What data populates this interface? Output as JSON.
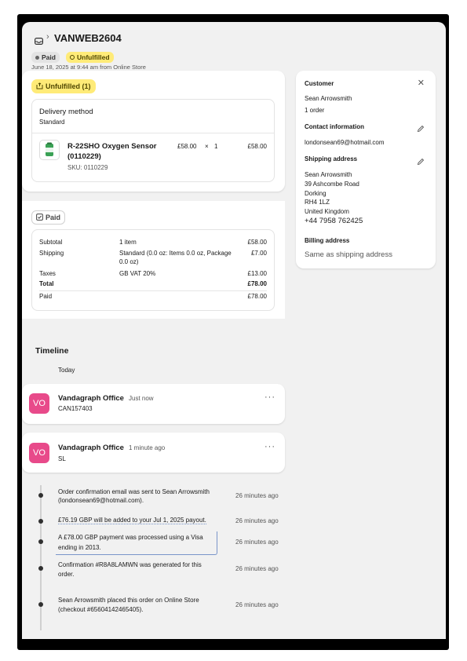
{
  "header": {
    "order_number": "VANWEB2604",
    "paid_badge": "Paid",
    "fulfillment_badge": "Unfulfilled",
    "date_line": "June 18, 2025 at 9:44 am from Online Store"
  },
  "fulfillment": {
    "status_label": "Unfulfilled (1)",
    "delivery_method_label": "Delivery method",
    "delivery_method": "Standard",
    "item": {
      "name_line1": "R-22SHO Oxygen Sensor",
      "name_line2": "(0110229)",
      "sku": "SKU: 0110229",
      "unit_price": "£58.00",
      "times": "×",
      "quantity": "1",
      "total": "£58.00"
    }
  },
  "payment": {
    "status_label": "Paid",
    "rows": {
      "subtotal": {
        "label": "Subtotal",
        "desc": "1 item",
        "amount": "£58.00"
      },
      "shipping": {
        "label": "Shipping",
        "desc_line1": "Standard (0.0 oz: Items 0.0 oz, Package",
        "desc_line2": "0.0 oz)",
        "amount": "£7.00"
      },
      "taxes": {
        "label": "Taxes",
        "desc": "GB VAT 20%",
        "amount": "£13.00"
      },
      "total": {
        "label": "Total",
        "amount": "£78.00"
      },
      "paid": {
        "label": "Paid",
        "amount": "£78.00"
      }
    }
  },
  "customer": {
    "section_title": "Customer",
    "name": "Sean Arrowsmith",
    "orders": "1 order",
    "contact_title": "Contact information",
    "email": "londonsean69@hotmail.com",
    "shipping_title": "Shipping address",
    "address": [
      "Sean Arrowsmith",
      "39 Ashcombe Road",
      "Dorking",
      "RH4 1LZ",
      "United Kingdom"
    ],
    "phone": "+44 7958 762425",
    "billing_title": "Billing address",
    "billing_value": "Same as shipping address"
  },
  "timeline": {
    "title": "Timeline",
    "today_label": "Today",
    "comments": [
      {
        "initials": "VO",
        "author": "Vandagraph Office",
        "time": "Just now",
        "text": "CAN157403",
        "more": "···"
      },
      {
        "initials": "VO",
        "author": "Vandagraph Office",
        "time": "1 minute ago",
        "text": "SL",
        "more": "···"
      }
    ],
    "events": [
      {
        "line1": "Order confirmation email was sent to Sean Arrowsmith",
        "line2": "(londonsean69@hotmail.com).",
        "time": "26 minutes ago"
      },
      {
        "line1": "£76.19 GBP will be added to your Jul 1, 2025 payout.",
        "line2": "",
        "time": "26 minutes ago"
      },
      {
        "line1": "A £78.00 GBP payment was processed using a Visa",
        "line2": "ending in 2013.",
        "time": "26 minutes ago"
      },
      {
        "line1": "Confirmation #R8A8LAMWN was generated for this",
        "line2": "order.",
        "time": "26 minutes ago"
      },
      {
        "line1": "Sean Arrowsmith placed this order on Online Store",
        "line2": "(checkout #65604142465405).",
        "time": "26 minutes ago"
      }
    ]
  },
  "colors": {
    "unfulfilled_bg": "#ffeb78",
    "paid_bg": "#e3e3e3",
    "avatar": "#e84a8a",
    "page_bg": "#f1f1f1"
  }
}
